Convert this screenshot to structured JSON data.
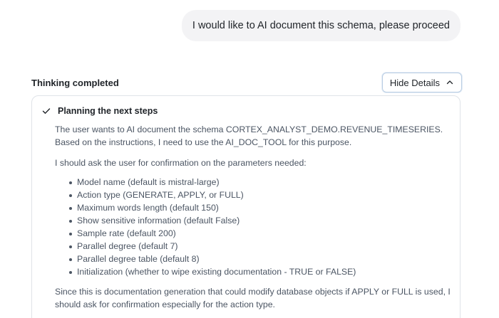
{
  "user_message": {
    "text": "I would like to AI document this schema, please proceed"
  },
  "thinking": {
    "status_label": "Thinking completed",
    "toggle_label": "Hide Details",
    "toggle_icon": "chevron-up-icon",
    "step": {
      "icon": "check-icon",
      "title": "Planning the next steps"
    },
    "paragraph_1": "The user wants to AI document the schema CORTEX_ANALYST_DEMO.REVENUE_TIMESERIES. Based on the instructions, I need to use the AI_DOC_TOOL for this purpose.",
    "paragraph_2": "I should ask the user for confirmation on the parameters needed:",
    "parameters": [
      "Model name (default is mistral-large)",
      "Action type (GENERATE, APPLY, or FULL)",
      "Maximum words length (default 150)",
      "Show sensitive information (default False)",
      "Sample rate (default 200)",
      "Parallel degree (default 7)",
      "Parallel degree table (default 8)",
      "Initialization (whether to wipe existing documentation - TRUE or FALSE)"
    ],
    "paragraph_3": "Since this is documentation generation that could modify database objects if APPLY or FULL is used, I should ask for confirmation especially for the action type."
  }
}
